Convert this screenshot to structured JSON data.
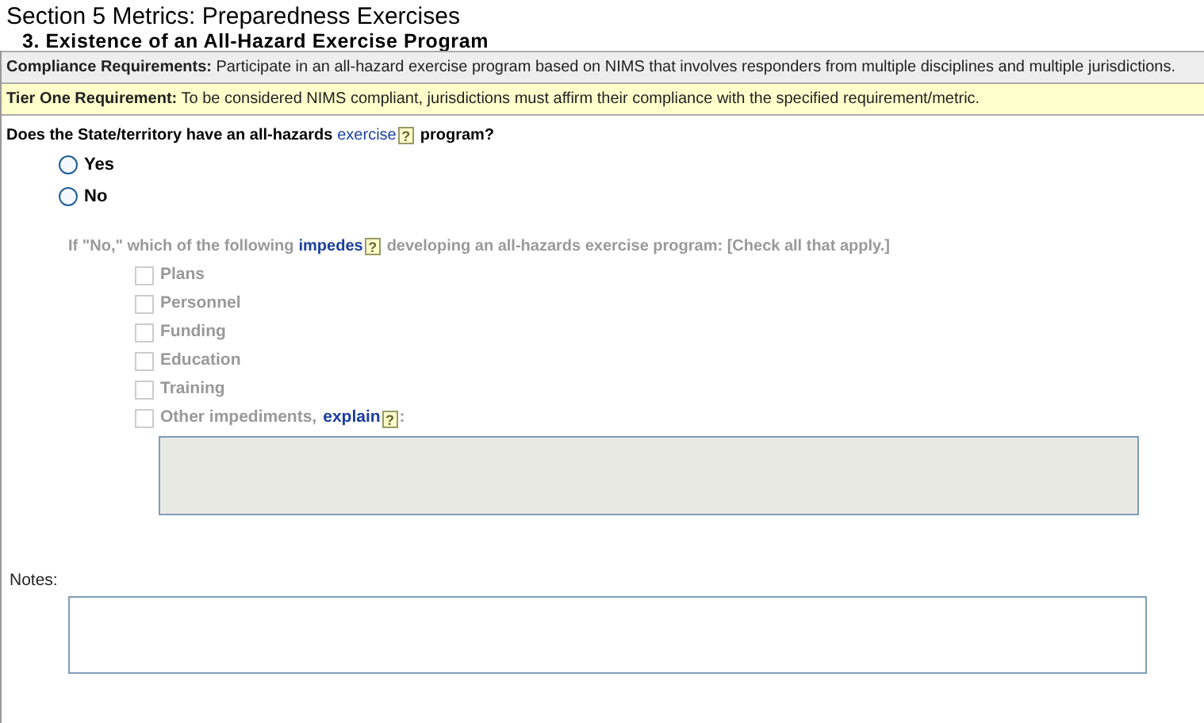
{
  "section_title": "Section 5 Metrics:  Preparedness Exercises",
  "metric_title": "3. Existence of an All-Hazard Exercise Program",
  "compliance": {
    "label": "Compliance Requirements:",
    "text": "Participate in an all-hazard exercise program based on NIMS that involves responders from multiple disciplines and multiple jurisdictions."
  },
  "tier_one": {
    "label": "Tier One Requirement:",
    "text": "To be considered NIMS compliant, jurisdictions must affirm their compliance with the specified requirement/metric."
  },
  "question": {
    "before": "Does the State/territory have an all-hazards",
    "link": "exercise",
    "help": "?",
    "after": "program?"
  },
  "answers": [
    {
      "label": "Yes",
      "selected": false
    },
    {
      "label": "No",
      "selected": false
    }
  ],
  "impediments": {
    "disabled": true,
    "before": "If \"No,\" which of the following",
    "link": "impedes",
    "help": "?",
    "after": "developing an all-hazards exercise program: [Check all that apply.]",
    "options": [
      {
        "label": "Plans",
        "checked": false
      },
      {
        "label": "Personnel",
        "checked": false
      },
      {
        "label": "Funding",
        "checked": false
      },
      {
        "label": "Education",
        "checked": false
      },
      {
        "label": "Training",
        "checked": false
      },
      {
        "label": "Other impediments,",
        "checked": false,
        "link": "explain",
        "help": "?",
        "after": ":"
      }
    ]
  },
  "notes": {
    "label": "Notes:"
  }
}
